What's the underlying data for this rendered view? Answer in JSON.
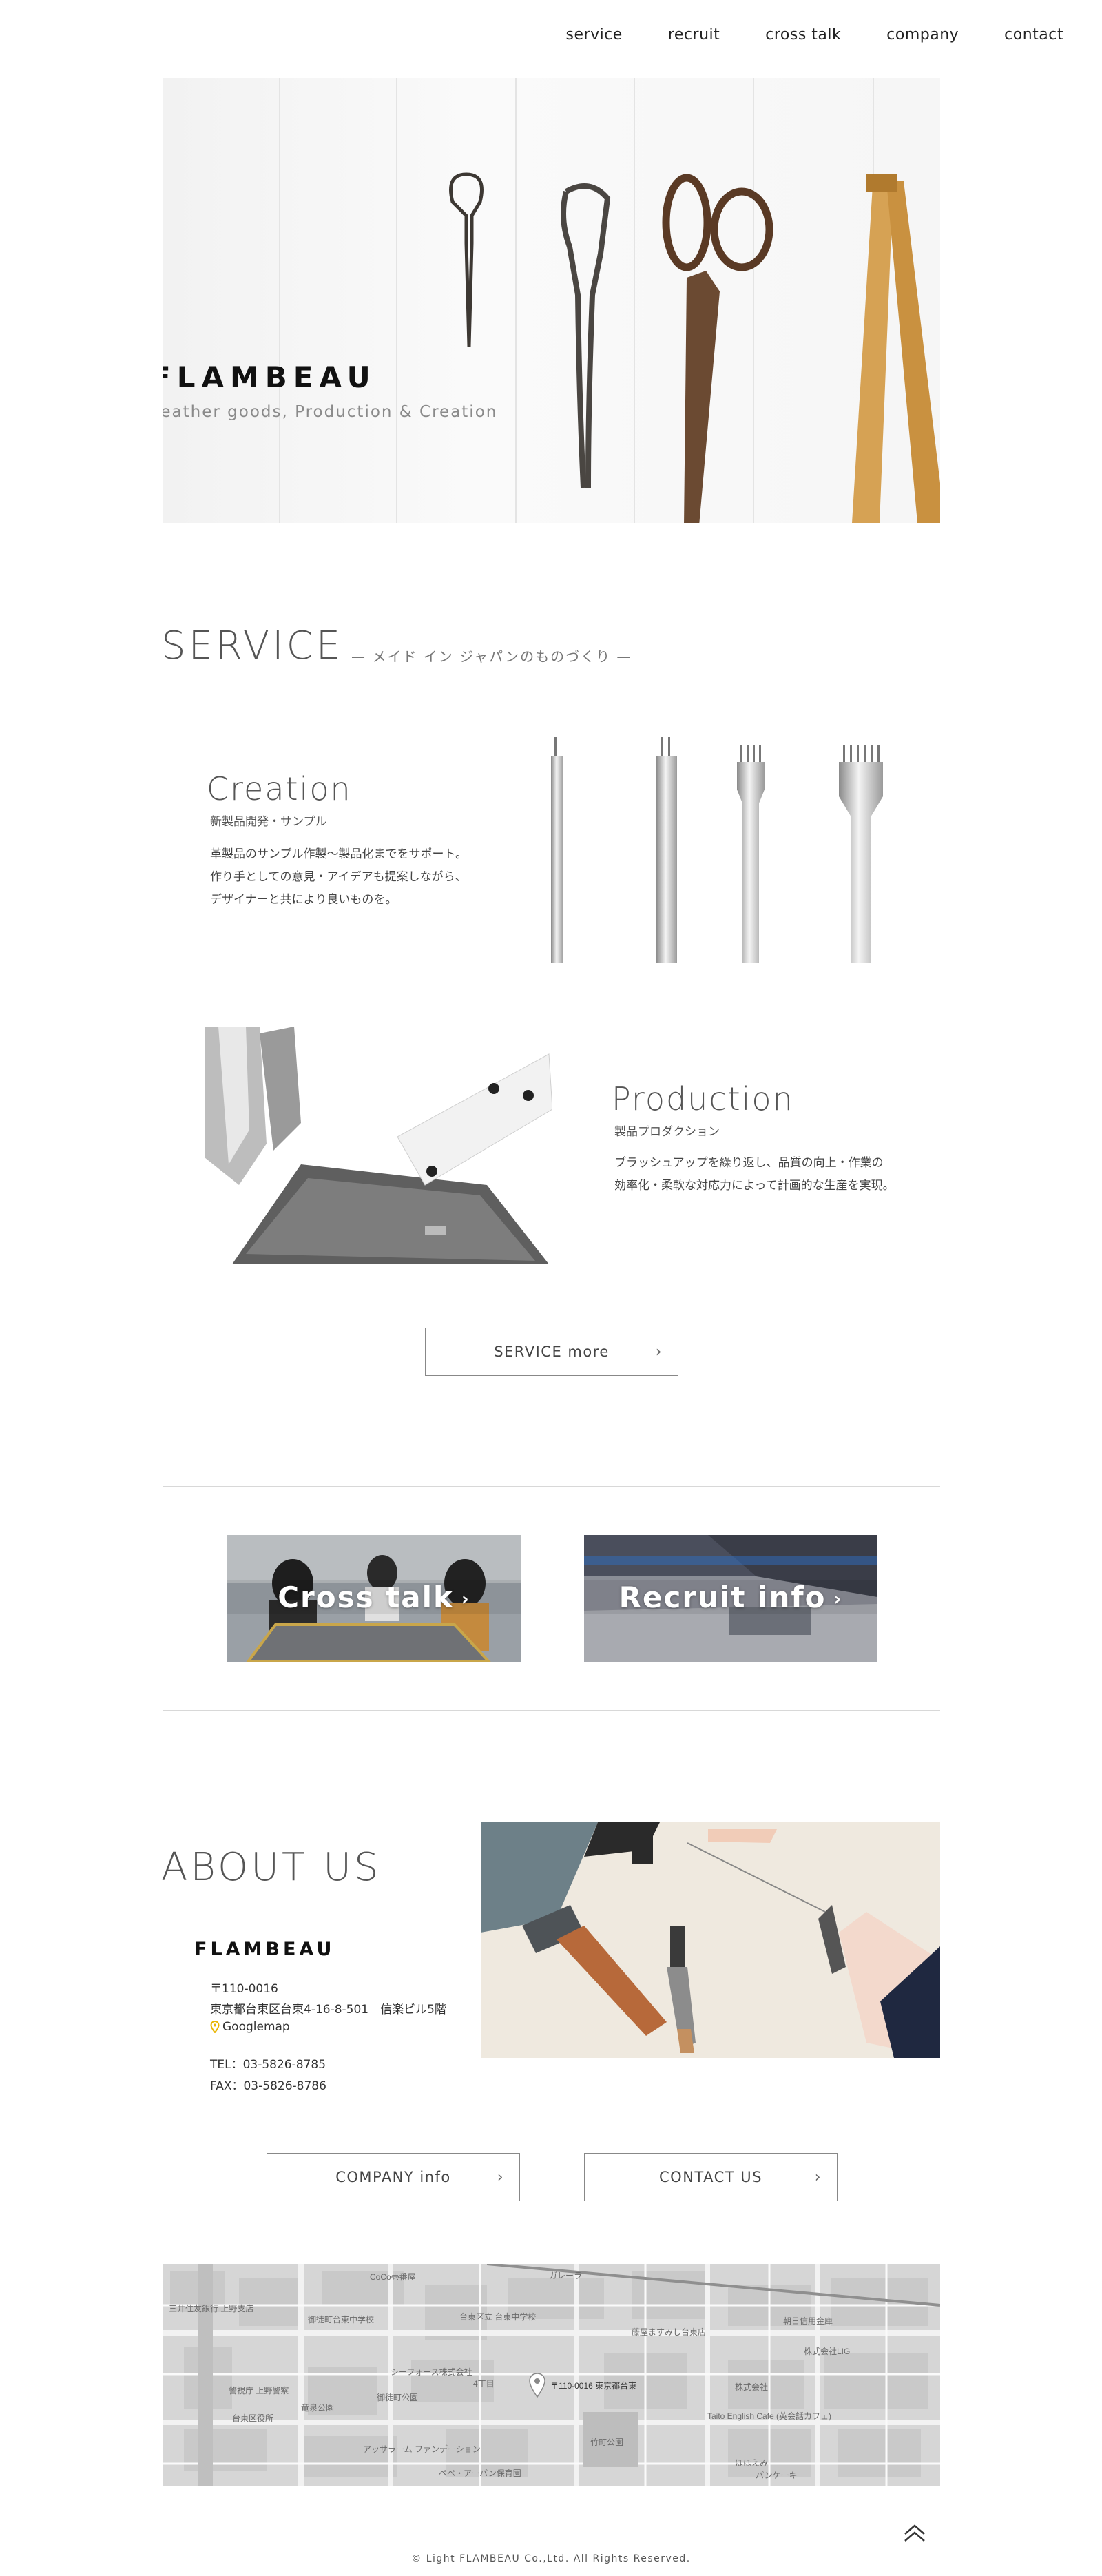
{
  "nav": {
    "items": [
      {
        "label": "service"
      },
      {
        "label": "recruit"
      },
      {
        "label": "cross talk"
      },
      {
        "label": "company"
      },
      {
        "label": "contact"
      }
    ]
  },
  "hero": {
    "title": "FLAMBEAU",
    "subtitle": "Leather goods, Production & Creation"
  },
  "service": {
    "heading": "SERVICE",
    "subheading": "— メイド イン ジャパンのものづくり —",
    "creation": {
      "title": "Creation",
      "subtitle": "新製品開発・サンプル",
      "body": [
        "革製品のサンプル作製～製品化までをサポート。",
        "作り手としての意見・アイデアも提案しながら、",
        "デザイナーと共により良いものを。"
      ]
    },
    "production": {
      "title": "Production",
      "subtitle": "製品プロダクション",
      "body": [
        "ブラッシュアップを繰り返し、品質の向上・作業の",
        "効率化・柔軟な対応力によって計画的な生産を実現。"
      ]
    },
    "more_button": "SERVICE more"
  },
  "banners": {
    "crosstalk": "Cross talk",
    "recruit": "Recruit info"
  },
  "about": {
    "heading": "ABOUT US",
    "logo": "FLAMBEAU",
    "postal": "〒110-0016",
    "address": "東京都台東区台東4-16-8-501　信楽ビル5階",
    "maplink": "Googlemap",
    "tel": "TEL：03-5826-8785",
    "fax": "FAX：03-5826-8786",
    "company_button": "COMPANY info",
    "contact_button": "CONTACT US"
  },
  "map": {
    "pin_label": "〒110-0016 東京都台東",
    "labels": [
      "三井住友銀行 上野支店",
      "御徒町台東中学校",
      "CoCo壱番屋",
      "ガレーラ",
      "台東区立 台東中学校",
      "シーフォース株式会社",
      "株式会社LIG",
      "Taito English Cafe (英会話カフェ)",
      "竹町公園",
      "ペペ・アーバン保育園",
      "アッサラーム ファンデーション",
      "警視庁 上野警察",
      "御徒町公園",
      "竜泉公園",
      "4丁目",
      "朝日信用金庫",
      "台東区役所",
      "株式会社",
      "ほほえみ",
      "パンケーキ",
      "藤屋ますみし台東店"
    ]
  },
  "footer": {
    "copyright": "© Light FLAMBEAU Co.,Ltd. All Rights Reserved."
  },
  "icons": {
    "pagetop": "double-chevron-up-icon",
    "map_pin": "map-pin-icon",
    "chevron": "chevron-right-icon"
  },
  "colors": {
    "accent_pin": "#e8b400",
    "text_dark": "#111111",
    "rule": "#d8d8d8"
  }
}
